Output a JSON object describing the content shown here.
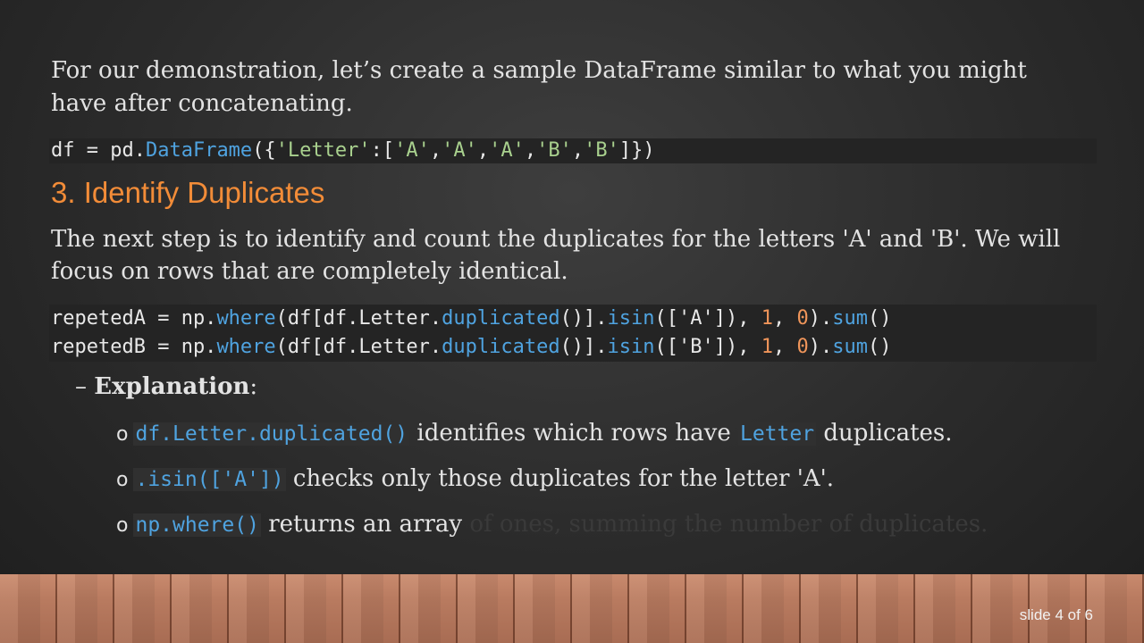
{
  "intro": "For our demonstration, let’s create a sample DataFrame similar to what you might have after concatenating.",
  "code1": {
    "a": "df = pd.",
    "b": "DataFrame",
    "c": "({",
    "d": "'Letter'",
    "e": ":[",
    "f": "'A'",
    "g": ",",
    "h": "'A'",
    "i": ",",
    "j": "'A'",
    "k": ",",
    "l": "'B'",
    "m": ",",
    "n": "'B'",
    "o": "]})"
  },
  "heading": "3. Identify Duplicates",
  "paragraph": "The next step is to identify and count the duplicates for the letters 'A' and 'B'. We will focus on rows that are completely identical.",
  "code2": {
    "line1": {
      "a": "repetedA = np.",
      "b": "where",
      "c": "(df[df.Letter.",
      "d": "duplicated",
      "e": "()].",
      "f": "isin",
      "g": "(['A']), ",
      "h": "1",
      "i": ", ",
      "j": "0",
      "k": ").",
      "l": "sum",
      "m": "()"
    },
    "line2": {
      "a": "repetedB = np.",
      "b": "where",
      "c": "(df[df.Letter.",
      "d": "duplicated",
      "e": "()].",
      "f": "isin",
      "g": "(['B']), ",
      "h": "1",
      "i": ", ",
      "j": "0",
      "k": ").",
      "l": "sum",
      "m": "()"
    }
  },
  "explanation": {
    "dash": "–",
    "label": "Explanation",
    "colon": ":"
  },
  "sub_bullets": [
    {
      "marker": "o",
      "code": "df.Letter.duplicated()",
      "text1": " identifies which rows have ",
      "code2": "Letter",
      "text2": " duplicates."
    },
    {
      "marker": "o",
      "code": ".isin(['A'])",
      "text1": " checks only those duplicates for the letter 'A'."
    },
    {
      "marker": "o",
      "code": "np.where()",
      "text1": " returns an array",
      "faded": " of ones, summing the number of duplicates."
    }
  ],
  "slide_number": "slide 4 of 6",
  "colors": {
    "accent": "#f28c38",
    "code_function": "#4fa3e0",
    "code_string": "#a9d18e",
    "code_number": "#f0955a"
  }
}
